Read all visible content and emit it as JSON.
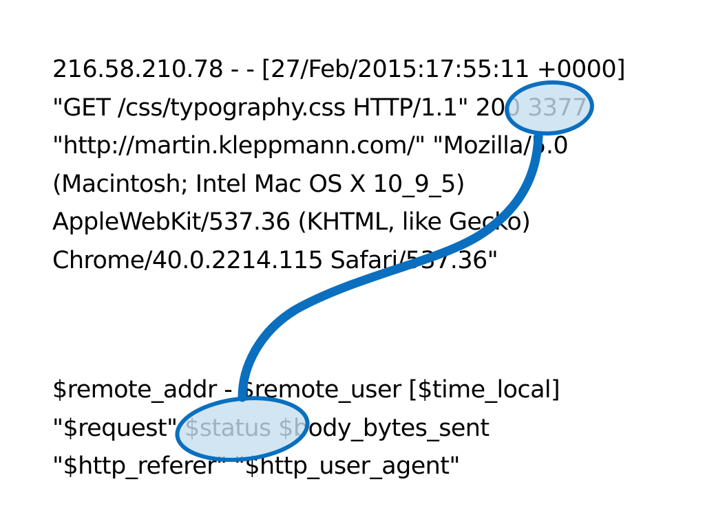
{
  "slide": {
    "log_line": [
      "216.58.210.78 - - [27/Feb/2015:17:55:11 +0000]",
      "\"GET /css/typography.css HTTP/1.1\" 200 3377",
      "\"http://martin.kleppmann.com/\" \"Mozilla/5.0",
      "(Macintosh; Intel Mac OS X 10_9_5)",
      "AppleWebKit/537.36 (KHTML, like Gecko)",
      "Chrome/40.0.2214.115 Safari/537.36\""
    ],
    "log_format": [
      "$remote_addr - $remote_user [$time_local]",
      "\"$request\" $status $body_bytes_sent",
      "\"$http_referer\" \"$http_user_agent\""
    ]
  },
  "colors": {
    "text": "#000000",
    "annotation_stroke": "#0a6fbf",
    "annotation_fill": "#c6deef",
    "background": "#ffffff"
  }
}
